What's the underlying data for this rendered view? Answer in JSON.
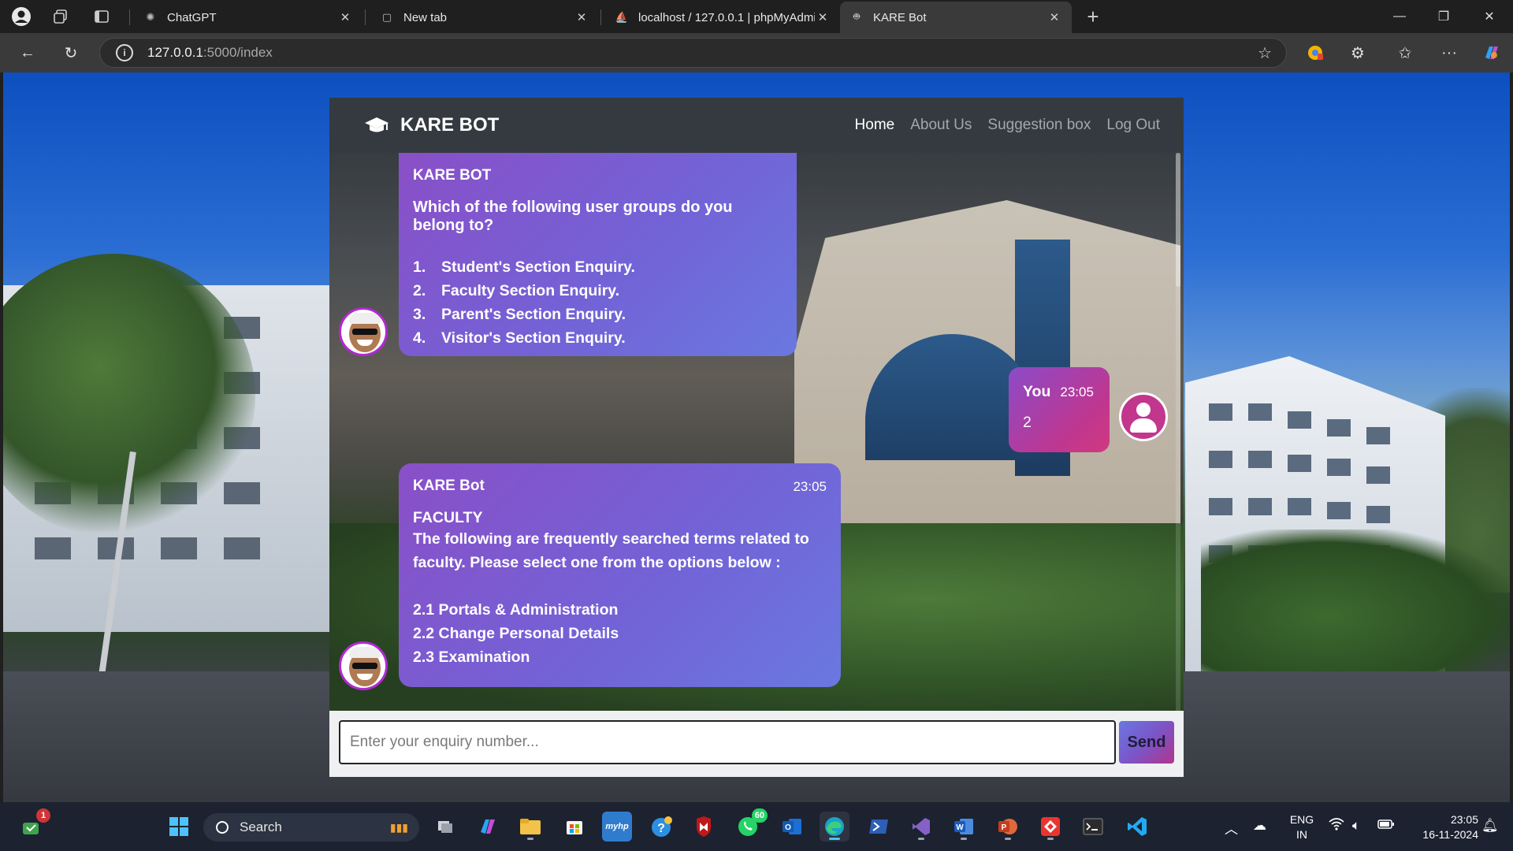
{
  "browser": {
    "tabs": [
      {
        "title": "ChatGPT",
        "favicon": "chatgpt-icon"
      },
      {
        "title": "New tab",
        "favicon": "newtab-icon"
      },
      {
        "title": "localhost / 127.0.0.1 | phpMyAdmin",
        "favicon": "phpmyadmin-icon"
      },
      {
        "title": "KARE Bot",
        "favicon": "bot-icon"
      }
    ],
    "url_host": "127.0.0.1",
    "url_path": ":5000/index"
  },
  "app": {
    "brand": "KARE BOT",
    "nav": {
      "home": "Home",
      "about": "About Us",
      "suggestion": "Suggestion box",
      "logout": "Log Out"
    },
    "messages": {
      "bot1": {
        "sender": "KARE BOT",
        "question": "Which of the following user groups do you belong to?",
        "options": [
          {
            "num": "1.",
            "text": "Student's Section Enquiry."
          },
          {
            "num": "2.",
            "text": "Faculty Section Enquiry."
          },
          {
            "num": "3.",
            "text": "Parent's Section Enquiry."
          },
          {
            "num": "4.",
            "text": "Visitor's Section Enquiry."
          }
        ]
      },
      "user1": {
        "sender": "You",
        "time": "23:05",
        "text": "2"
      },
      "bot2": {
        "sender": "KARE Bot",
        "time": "23:05",
        "heading": "FACULTY",
        "body": "The following are frequently searched terms related to faculty. Please select one from the options below :",
        "options": [
          "2.1 Portals & Administration",
          "2.2 Change Personal Details",
          "2.3 Examination"
        ]
      }
    },
    "input": {
      "placeholder": "Enter your enquiry number...",
      "send_label": "Send"
    }
  },
  "taskbar": {
    "search_label": "Search",
    "notification_badge": "1",
    "whatsapp_badge": "60",
    "lang_top": "ENG",
    "lang_bottom": "IN",
    "time": "23:05",
    "date": "16-11-2024"
  },
  "colors": {
    "nav_bg": "#343a40",
    "bot_bubble": "#7362d6",
    "user_bubble": "#c0368f",
    "taskbar_bg": "#1c2230"
  }
}
